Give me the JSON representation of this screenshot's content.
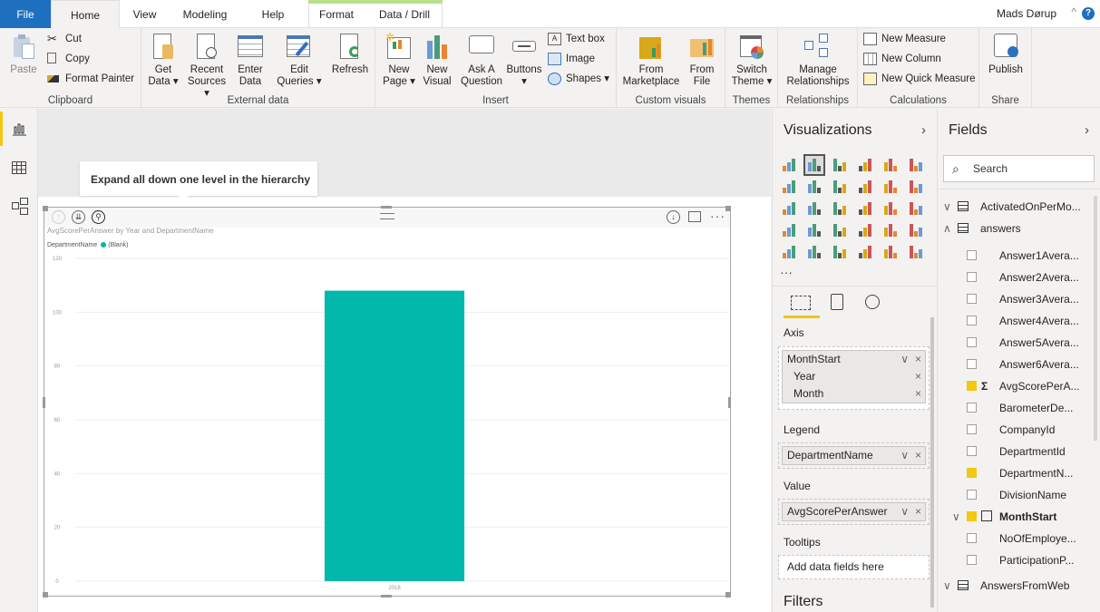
{
  "tabs": {
    "file": "File",
    "home": "Home",
    "view": "View",
    "modeling": "Modeling",
    "help": "Help",
    "format": "Format",
    "data_drill": "Data / Drill"
  },
  "user": {
    "name": "Mads Dørup",
    "help_label": "?"
  },
  "ribbon": {
    "clipboard": {
      "label": "Clipboard",
      "paste": "Paste",
      "cut": "Cut",
      "copy": "Copy",
      "format_painter": "Format Painter"
    },
    "external_data": {
      "label": "External data",
      "get_data": [
        "Get",
        "Data ▾"
      ],
      "recent_sources": [
        "Recent",
        "Sources ▾"
      ],
      "enter_data": [
        "Enter",
        "Data"
      ],
      "edit_queries": [
        "Edit",
        "Queries ▾"
      ],
      "refresh": "Refresh"
    },
    "insert": {
      "label": "Insert",
      "new_page": [
        "New",
        "Page ▾"
      ],
      "new_visual": [
        "New",
        "Visual"
      ],
      "ask_question": [
        "Ask A",
        "Question"
      ],
      "buttons": [
        "Buttons",
        "▾"
      ],
      "text_box": "Text box",
      "image": "Image",
      "shapes": "Shapes ▾"
    },
    "custom_visuals": {
      "label": "Custom visuals",
      "from_marketplace": [
        "From",
        "Marketplace"
      ],
      "from_file": [
        "From",
        "File"
      ]
    },
    "themes": {
      "label": "Themes",
      "switch_theme": [
        "Switch",
        "Theme ▾"
      ]
    },
    "relationships": {
      "label": "Relationships",
      "manage": [
        "Manage",
        "Relationships"
      ]
    },
    "calculations": {
      "label": "Calculations",
      "new_measure": "New Measure",
      "new_column": "New Column",
      "new_quick_measure": "New Quick Measure"
    },
    "share": {
      "label": "Share",
      "publish": "Publish"
    }
  },
  "tooltip": "Expand all down one level in the hierarchy",
  "visual": {
    "title": "AvgScorePerAnswer by Year and DepartmentName",
    "legend_title": "DepartmentName",
    "legend_item": "(Blank)"
  },
  "chart_data": {
    "type": "bar",
    "title": "AvgScorePerAnswer by Year and DepartmentName",
    "categories": [
      "2018"
    ],
    "series": [
      {
        "name": "(Blank)",
        "values": [
          108
        ],
        "color": "#01b8aa"
      }
    ],
    "xlabel": "",
    "ylabel": "",
    "ylim": [
      0,
      120
    ],
    "yticks": [
      0,
      20,
      40,
      60,
      80,
      100,
      120
    ],
    "grid": true,
    "legend": "top-left"
  },
  "visualizations": {
    "title": "Visualizations",
    "axis_label": "Axis",
    "axis_field": "MonthStart",
    "axis_sub": [
      "Year",
      "Month"
    ],
    "legend_label": "Legend",
    "legend_field": "DepartmentName",
    "value_label": "Value",
    "value_field": "AvgScorePerAnswer",
    "tooltips_label": "Tooltips",
    "tooltips_placeholder": "Add data fields here",
    "filters_label": "Filters",
    "more": "..."
  },
  "fields": {
    "title": "Fields",
    "search_placeholder": "Search",
    "tables": [
      {
        "name": "ActivatedOnPerMo...",
        "expanded": false
      },
      {
        "name": "answers",
        "expanded": true
      },
      {
        "name": "AnswersFromWeb",
        "expanded": false
      }
    ],
    "answers_fields": [
      {
        "name": "Answer1Avera...",
        "checked": false
      },
      {
        "name": "Answer2Avera...",
        "checked": false
      },
      {
        "name": "Answer3Avera...",
        "checked": false
      },
      {
        "name": "Answer4Avera...",
        "checked": false
      },
      {
        "name": "Answer5Avera...",
        "checked": false
      },
      {
        "name": "Answer6Avera...",
        "checked": false
      },
      {
        "name": "AvgScorePerA...",
        "checked": true
      },
      {
        "name": "BarometerDe...",
        "checked": false
      },
      {
        "name": "CompanyId",
        "checked": false
      },
      {
        "name": "DepartmentId",
        "checked": false
      },
      {
        "name": "DepartmentN...",
        "checked": true
      },
      {
        "name": "DivisionName",
        "checked": false
      },
      {
        "name": "MonthStart",
        "checked": true
      },
      {
        "name": "NoOfEmploye...",
        "checked": false
      },
      {
        "name": "ParticipationP...",
        "checked": false
      }
    ]
  },
  "colors": {
    "accent": "#f2c811",
    "file_tab": "#1f6fbf",
    "bar": "#01b8aa",
    "context_tab": "#b8e08a"
  }
}
